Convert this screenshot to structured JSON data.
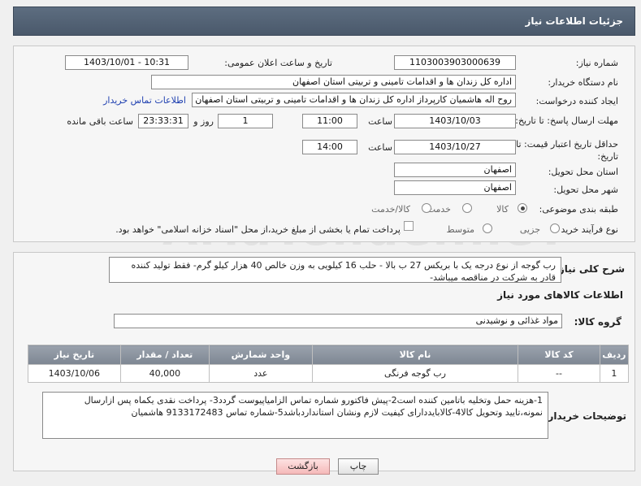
{
  "header": {
    "title": "جزئیات اطلاعات نیاز"
  },
  "form": {
    "need_number_label": "شماره نیاز:",
    "need_number": "1103003903000639",
    "announce_label": "تاریخ و ساعت اعلان عمومی:",
    "announce_value": "1403/10/01 - 10:31",
    "buyer_org_label": "نام دستگاه خریدار:",
    "buyer_org": "اداره کل زندان ها و اقدامات تامینی و تربیتی استان اصفهان",
    "requester_label": "ایجاد کننده درخواست:",
    "requester": "روح اله هاشمیان کارپرداز اداره کل زندان ها و اقدامات تامینی و تربیتی استان اصفهان",
    "contact_link": "اطلاعات تماس خریدار",
    "deadline_label": "مهلت ارسال پاسخ: تا تاریخ:",
    "deadline_date": "1403/10/03",
    "time_label": "ساعت",
    "deadline_time": "11:00",
    "days_value": "1",
    "days_label": "روز و",
    "remaining_time": "23:33:31",
    "remaining_label": "ساعت باقی مانده",
    "validity_label": "حداقل تاریخ اعتبار قیمت: تا تاریخ:",
    "validity_date": "1403/10/27",
    "validity_time": "14:00",
    "province_label": "استان محل تحویل:",
    "province": "اصفهان",
    "city_label": "شهر محل تحویل:",
    "city": "اصفهان",
    "category_label": "طبقه بندی موضوعی:",
    "category_options": [
      "کالا",
      "خدمت",
      "کالا/خدمت"
    ],
    "process_label": "نوع فرآیند خرید :",
    "process_options": [
      "جزیی",
      "متوسط"
    ],
    "treasury_note": "پرداخت تمام یا بخشی از مبلغ خرید،از محل \"اسناد خزانه اسلامی\" خواهد بود."
  },
  "summary": {
    "label": "شرح کلی نیاز:",
    "text": "رب گوجه از نوع درجه یک با بریکس 27 ب بالا - حلب 16 کیلویی به وزن خالص 40 هزار کیلو گرم- فقط تولید کننده قادر به شرکت در مناقصه میباشد-"
  },
  "goods": {
    "section_title": "اطلاعات کالاهای مورد نیاز",
    "group_label": "گروه کالا:",
    "group_value": "مواد غذائی و نوشیدنی",
    "columns": [
      "ردیف",
      "کد کالا",
      "نام کالا",
      "واحد شمارش",
      "تعداد / مقدار",
      "تاریخ نیاز"
    ],
    "rows": [
      {
        "row": "1",
        "code": "--",
        "name": "رب گوجه فرنگی",
        "unit": "عدد",
        "qty": "40,000",
        "date": "1403/10/06"
      }
    ]
  },
  "buyer_notes": {
    "label": "توضیحات خریدار:",
    "text": "1-هزینه حمل وتخلیه باتامین کننده است2-پیش فاکتورو شماره تماس الزامیاپیوست گردد3- پرداخت نقدی یکماه  پس ازارسال نمونه،تایید وتحویل کالا4-کالابایددارای کیفیت لازم ونشان استانداردباشد5-شماره تماس 9133172483 هاشمیان"
  },
  "buttons": {
    "print": "چاپ",
    "back": "بازگشت"
  },
  "watermark": "AriaTender.neT"
}
